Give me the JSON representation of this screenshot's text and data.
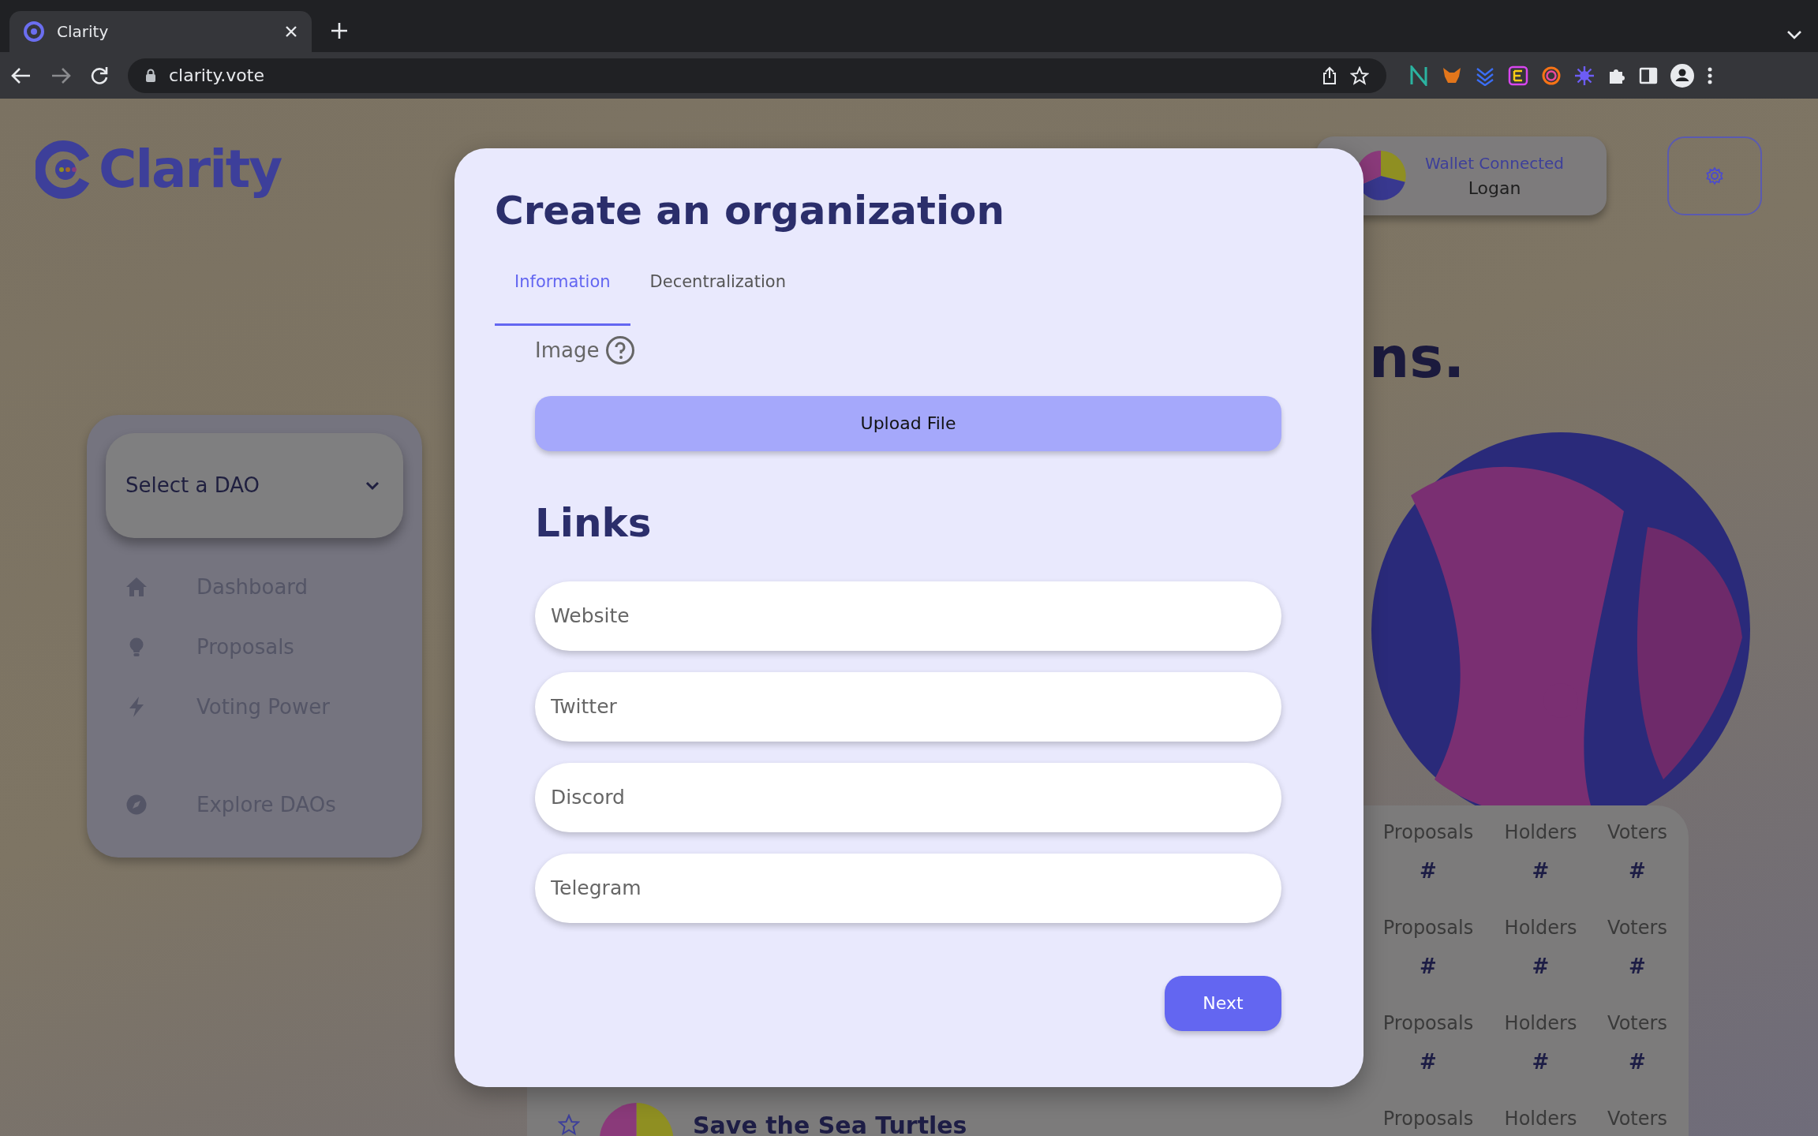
{
  "browser": {
    "tab_title": "Clarity",
    "address": "clarity.vote"
  },
  "page": {
    "logo_text": "Clarity",
    "wallet": {
      "status": "Wallet Connected",
      "name": "Logan"
    },
    "dao_select": {
      "placeholder": "Select a DAO"
    },
    "nav": [
      {
        "label": "Dashboard"
      },
      {
        "label": "Proposals"
      },
      {
        "label": "Voting Power"
      },
      {
        "label": "Explore DAOs"
      }
    ],
    "headline": "ns.",
    "dao_rows": [
      {
        "stats": [
          {
            "label": "Proposals",
            "value": "#"
          },
          {
            "label": "Holders",
            "value": "#"
          },
          {
            "label": "Voters",
            "value": "#"
          }
        ]
      },
      {
        "stats": [
          {
            "label": "Proposals",
            "value": "#"
          },
          {
            "label": "Holders",
            "value": "#"
          },
          {
            "label": "Voters",
            "value": "#"
          }
        ]
      },
      {
        "stats": [
          {
            "label": "Proposals",
            "value": "#"
          },
          {
            "label": "Holders",
            "value": "#"
          },
          {
            "label": "Voters",
            "value": "#"
          }
        ]
      },
      {
        "name": "Save the Sea Turtles",
        "stats": [
          {
            "label": "Proposals"
          },
          {
            "label": "Holders"
          },
          {
            "label": "Voters"
          }
        ]
      }
    ]
  },
  "modal": {
    "title": "Create an organization",
    "tabs": [
      {
        "label": "Information",
        "selected": true
      },
      {
        "label": "Decentralization",
        "selected": false
      }
    ],
    "image_label": "Image",
    "upload_button": "Upload File",
    "links_heading": "Links",
    "fields": [
      {
        "placeholder": "Website"
      },
      {
        "placeholder": "Twitter"
      },
      {
        "placeholder": "Discord"
      },
      {
        "placeholder": "Telegram"
      }
    ],
    "next_button": "Next"
  }
}
